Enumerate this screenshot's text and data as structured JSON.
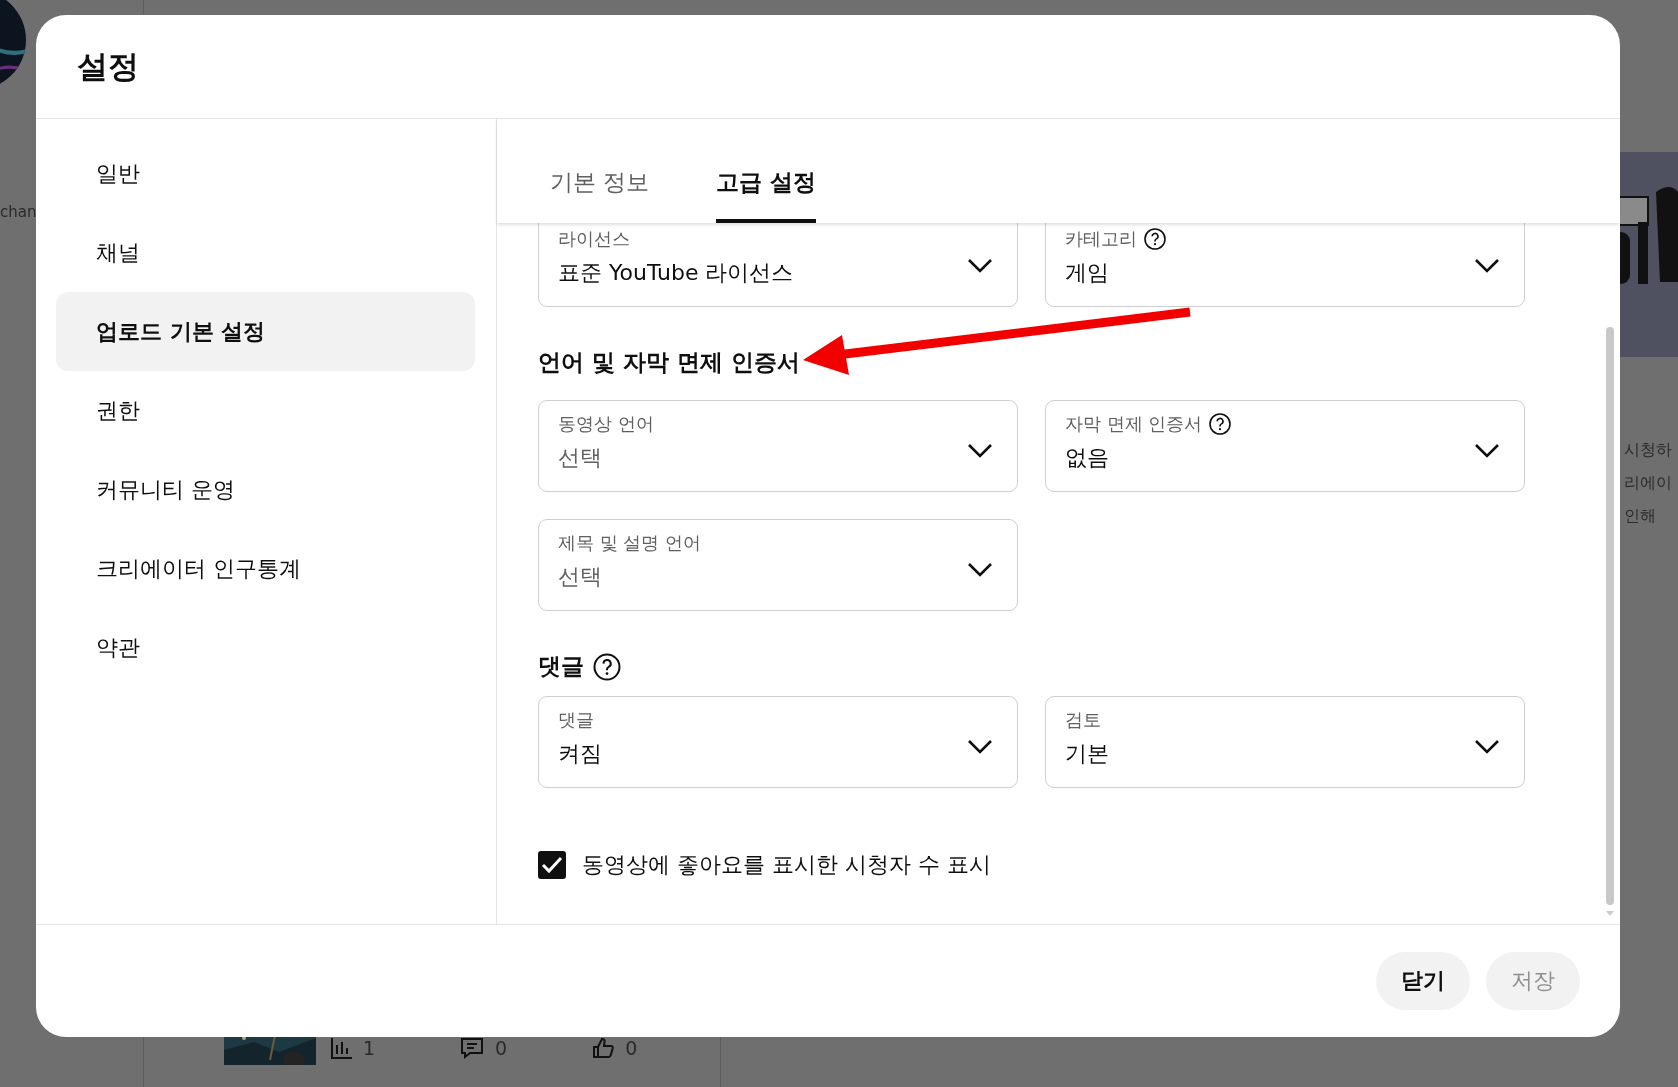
{
  "background": {
    "channel_text": "chan",
    "side_texts": [
      "시청하",
      "리에이",
      "인해"
    ],
    "stats": [
      {
        "kind": "views",
        "value": "1"
      },
      {
        "kind": "comments",
        "value": "0"
      },
      {
        "kind": "likes",
        "value": "0"
      }
    ]
  },
  "dialog": {
    "title": "설정",
    "sidebar": {
      "items": [
        {
          "label": "일반",
          "selected": false
        },
        {
          "label": "채널",
          "selected": false
        },
        {
          "label": "업로드 기본 설정",
          "selected": true
        },
        {
          "label": "권한",
          "selected": false
        },
        {
          "label": "커뮤니티 운영",
          "selected": false
        },
        {
          "label": "크리에이터 인구통계",
          "selected": false
        },
        {
          "label": "약관",
          "selected": false
        }
      ]
    },
    "tabs": [
      {
        "label": "기본 정보",
        "selected": false
      },
      {
        "label": "고급 설정",
        "selected": true
      }
    ],
    "sections": [
      {
        "fields": [
          {
            "label": "라이선스",
            "value": "표준 YouTube 라이선스",
            "help": false,
            "empty": false
          },
          {
            "label": "카테고리",
            "value": "게임",
            "help": true,
            "empty": false
          }
        ]
      },
      {
        "heading": "언어 및 자막 면제 인증서",
        "help": false,
        "fields": [
          {
            "label": "동영상 언어",
            "value": "선택",
            "help": false,
            "empty": true
          },
          {
            "label": "자막 면제 인증서",
            "value": "없음",
            "help": true,
            "empty": false
          },
          {
            "label": "제목 및 설명 언어",
            "value": "선택",
            "help": false,
            "empty": true
          }
        ]
      },
      {
        "heading": "댓글",
        "help": true,
        "fields": [
          {
            "label": "댓글",
            "value": "켜짐",
            "help": false,
            "empty": false
          },
          {
            "label": "검토",
            "value": "기본",
            "help": false,
            "empty": false
          }
        ]
      }
    ],
    "checkbox": {
      "label": "동영상에 좋아요를 표시한 시청자 수 표시",
      "checked": true
    },
    "buttons": [
      {
        "label": "닫기",
        "disabled": false
      },
      {
        "label": "저장",
        "disabled": true
      }
    ]
  }
}
